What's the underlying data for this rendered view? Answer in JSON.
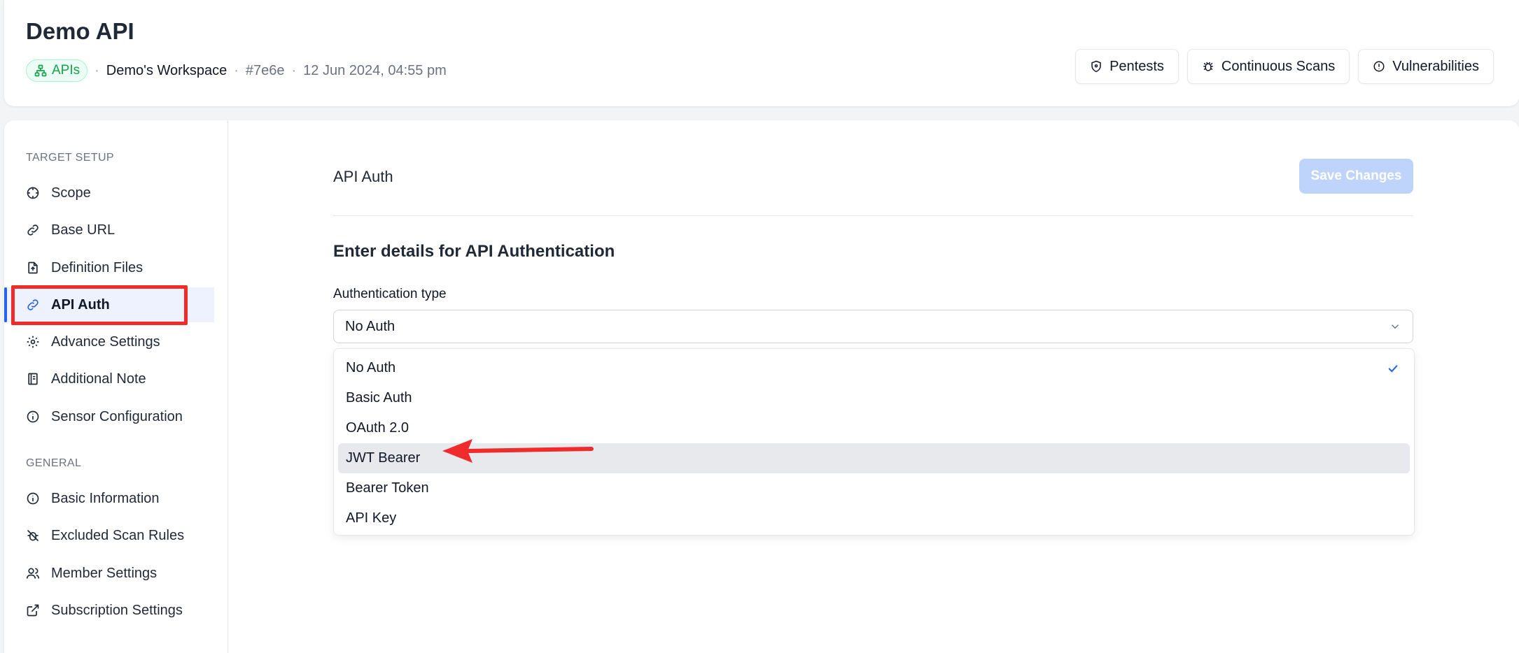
{
  "header": {
    "title": "Demo API",
    "badge_label": "APIs",
    "workspace": "Demo's Workspace",
    "id": "#7e6e",
    "timestamp": "12 Jun 2024, 04:55 pm",
    "separator": "·",
    "buttons": {
      "pentests": "Pentests",
      "continuous_scans": "Continuous Scans",
      "vulnerabilities": "Vulnerabilities"
    }
  },
  "sidebar": {
    "target_setup_label": "TARGET SETUP",
    "general_label": "GENERAL",
    "items": [
      {
        "label": "Scope",
        "icon": "crosshair-icon"
      },
      {
        "label": "Base URL",
        "icon": "link-icon"
      },
      {
        "label": "Definition Files",
        "icon": "file-upload-icon"
      },
      {
        "label": "API Auth",
        "icon": "link-icon",
        "active": true
      },
      {
        "label": "Advance Settings",
        "icon": "gear-icon"
      },
      {
        "label": "Additional Note",
        "icon": "notebook-icon"
      },
      {
        "label": "Sensor Configuration",
        "icon": "info-icon"
      },
      {
        "label": "Basic Information",
        "icon": "info-icon"
      },
      {
        "label": "Excluded Scan Rules",
        "icon": "bug-off-icon"
      },
      {
        "label": "Member Settings",
        "icon": "users-icon"
      },
      {
        "label": "Subscription Settings",
        "icon": "external-link-icon"
      }
    ]
  },
  "content": {
    "title": "API Auth",
    "save_label": "Save Changes",
    "heading": "Enter details for API Authentication",
    "field_label": "Authentication type",
    "selected_value": "No Auth",
    "options": [
      "No Auth",
      "Basic Auth",
      "OAuth 2.0",
      "JWT Bearer",
      "Bearer Token",
      "API Key"
    ],
    "highlighted_option": "JWT Bearer"
  },
  "colors": {
    "accent": "#2563eb",
    "badge_green": "#16a34a",
    "annotation_red": "#ef2b2b",
    "save_disabled": "#bfd4fb"
  }
}
